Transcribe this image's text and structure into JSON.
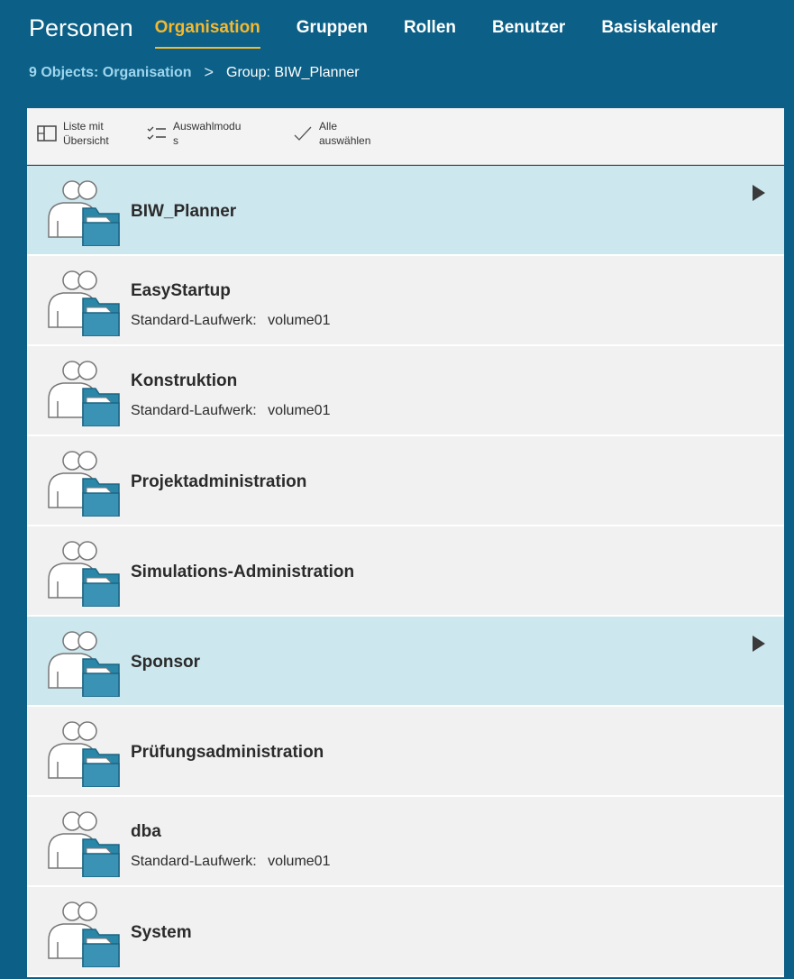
{
  "header": {
    "title": "Personen",
    "tabs": [
      {
        "label": "Organisation",
        "active": true
      },
      {
        "label": "Gruppen",
        "active": false
      },
      {
        "label": "Rollen",
        "active": false
      },
      {
        "label": "Benutzer",
        "active": false
      },
      {
        "label": "Basiskalender",
        "active": false
      }
    ],
    "breadcrumb": {
      "link": "9 Objects: Organisation",
      "separator": ">",
      "current": "Group: BIW_Planner"
    }
  },
  "toolbar": {
    "list_view": {
      "line1": "Liste mit",
      "line2": "Übersicht",
      "icon": "list-overview-icon"
    },
    "selection_mode": {
      "line1": "Auswahlmodu",
      "line2": "s",
      "icon": "checklist-icon"
    },
    "select_all": {
      "line1": "Alle",
      "line2": "auswählen",
      "icon": "checkmark-icon"
    }
  },
  "list": {
    "items": [
      {
        "name": "BIW_Planner",
        "selected": true,
        "has_arrow": true
      },
      {
        "name": "EasyStartup",
        "detail_label": "Standard-Laufwerk:",
        "detail_value": "volume01"
      },
      {
        "name": "Konstruktion",
        "detail_label": "Standard-Laufwerk:",
        "detail_value": "volume01"
      },
      {
        "name": "Projektadministration"
      },
      {
        "name": "Simulations-Administration"
      },
      {
        "name": "Sponsor",
        "selected": true,
        "has_arrow": true
      },
      {
        "name": "Prüfungsadministration"
      },
      {
        "name": "dba",
        "detail_label": "Standard-Laufwerk:",
        "detail_value": "volume01"
      },
      {
        "name": "System"
      }
    ]
  },
  "colors": {
    "header_bg": "#0c6087",
    "active_tab": "#f5b82e",
    "breadcrumb_link": "#9fd6ee",
    "row_bg": "#f1f1f1",
    "row_selected_bg": "#cde7ef"
  }
}
